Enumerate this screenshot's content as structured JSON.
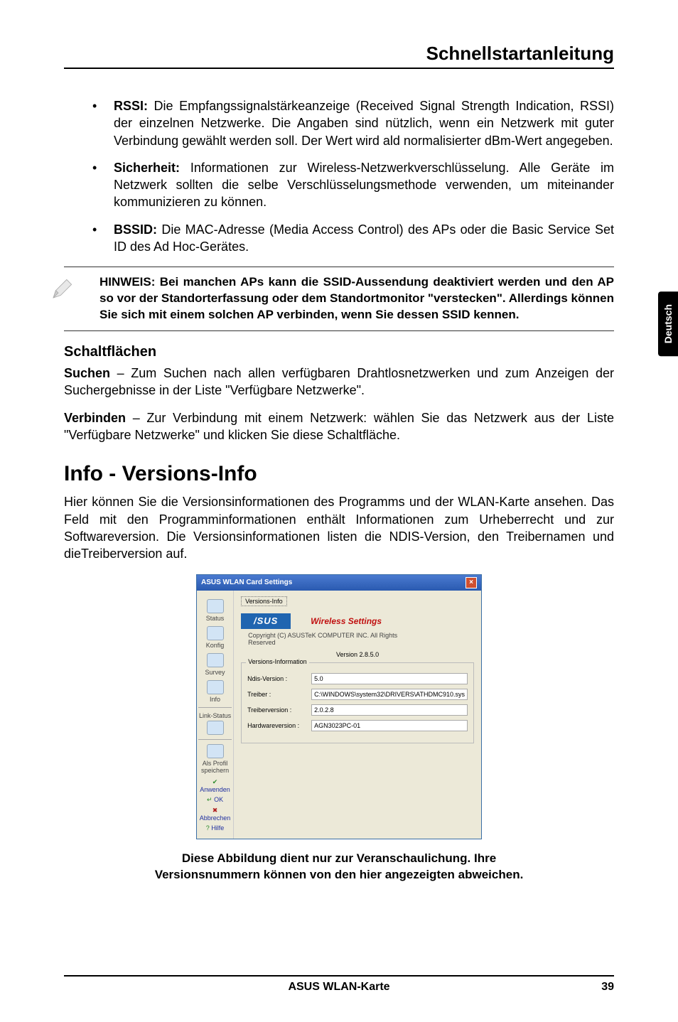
{
  "header": {
    "title": "Schnellstartanleitung"
  },
  "side_tab": "Deutsch",
  "bullets": [
    {
      "label": "RSSI:",
      "text": " Die Empfangssignalstärkeanzeige (Received Signal Strength Indication, RSSI) der einzelnen Netzwerke. Die Angaben sind nützlich, wenn ein Netzwerk mit guter Verbindung gewählt werden soll. Der Wert wird ald normalisierter dBm-Wert angegeben."
    },
    {
      "label": "Sicherheit:",
      "text": " Informationen zur Wireless-Netzwerkverschlüsselung. Alle Geräte im Netzwerk sollten die selbe Verschlüsselungsmethode verwenden, um miteinander kommunizieren zu können."
    },
    {
      "label": "BSSID:",
      "text": " Die MAC-Adresse (Media Access Control) des APs oder die Basic Service Set ID des Ad Hoc-Gerätes."
    }
  ],
  "note": "HINWEIS: Bei manchen APs kann die SSID-Aussendung deaktiviert werden und den AP so vor der Standorterfassung oder dem Standortmonitor \"verstecken\". Allerdings können Sie sich mit einem solchen AP verbinden, wenn Sie dessen SSID kennen.",
  "subtitle": "Schaltflächen",
  "para1": {
    "lead": "Suchen",
    "rest": " – Zum Suchen nach allen verfügbaren Drahtlosnetzwerken und zum Anzeigen der Suchergebnisse in der Liste \"Verfügbare Netzwerke\"."
  },
  "para2": {
    "lead": "Verbinden",
    "rest": " – Zur Verbindung mit einem Netzwerk: wählen Sie das Netzwerk aus der Liste \"Verfügbare Netzwerke\" und klicken Sie diese Schaltfläche."
  },
  "h2": "Info - Versions-Info",
  "intro": "Hier können Sie die Versionsinformationen des Programms und der WLAN-Karte ansehen. Das Feld mit den Programminformationen enthält Informationen zum Urheberrecht und zur Softwareversion. Die Versionsinformationen listen die NDIS-Version, den Treibernamen und dieTreiberversion auf.",
  "dialog": {
    "title": "ASUS WLAN Card Settings",
    "tab": "Versions-Info",
    "logo": "/SUS",
    "ws": "Wireless Settings",
    "copyright1": "Copyright (C) ASUSTeK COMPUTER INC. All Rights",
    "copyright2": "Reserved",
    "version_label": "Version 2.8.5.0",
    "group_label": "Versions-Information",
    "fields": {
      "ndis_l": "Ndis-Version :",
      "ndis_v": "5.0",
      "drv_l": "Treiber :",
      "drv_v": "C:\\WINDOWS\\system32\\DRIVERS\\ATHDMC910.sys",
      "drvver_l": "Treiberversion :",
      "drvver_v": "2.0.2.8",
      "hw_l": "Hardwareversion :",
      "hw_v": "AGN3023PC-01"
    },
    "side": {
      "status": "Status",
      "konfig": "Konfig",
      "survey": "Survey",
      "info": "Info",
      "linkstatus": "Link-Status",
      "saveprofile": "Als Profil speichern",
      "anwenden": "Anwenden",
      "ok": "OK",
      "abbrechen": "Abbrechen",
      "hilfe": "Hilfe"
    }
  },
  "caption": "Diese Abbildung dient nur zur Veranschaulichung. Ihre Versionsnummern können von den hier angezeigten abweichen.",
  "footer": {
    "center": "ASUS WLAN-Karte",
    "right": "39"
  }
}
